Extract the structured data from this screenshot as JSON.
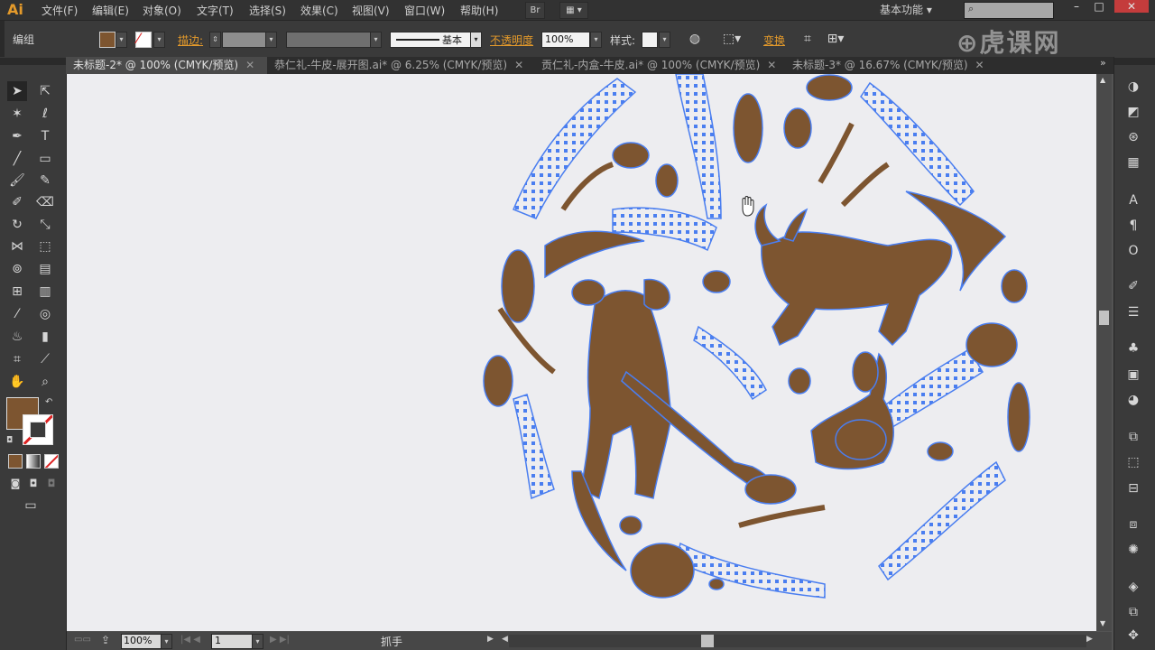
{
  "app": {
    "logo": "Ai"
  },
  "menu": [
    "文件(F)",
    "编辑(E)",
    "对象(O)",
    "文字(T)",
    "选择(S)",
    "效果(C)",
    "视图(V)",
    "窗口(W)",
    "帮助(H)"
  ],
  "bridge_label": "Br",
  "workspace_label": "基本功能",
  "watermark": "虎课网",
  "control": {
    "selection_label": "编组",
    "stroke_label": "描边:",
    "stroke_style": "基本",
    "opacity_label": "不透明度",
    "opacity_value": "100%",
    "style_label": "样式:",
    "recolor_label": "变换"
  },
  "tabs": [
    {
      "label": "未标题-2* @ 100% (CMYK/预览)",
      "active": true
    },
    {
      "label": "恭仁礼-牛皮-展开图.ai* @ 6.25% (CMYK/预览)",
      "active": false
    },
    {
      "label": "贡仁礼-内盒-牛皮.ai* @ 100% (CMYK/预览)",
      "active": false
    },
    {
      "label": "未标题-3* @ 16.67% (CMYK/预览)",
      "active": false
    }
  ],
  "status": {
    "zoom": "100%",
    "artboard": "1",
    "tool_name": "抓手"
  },
  "colors": {
    "fill": "#7d5530",
    "path": "#4a7ef0",
    "accent": "#e49a2b"
  }
}
